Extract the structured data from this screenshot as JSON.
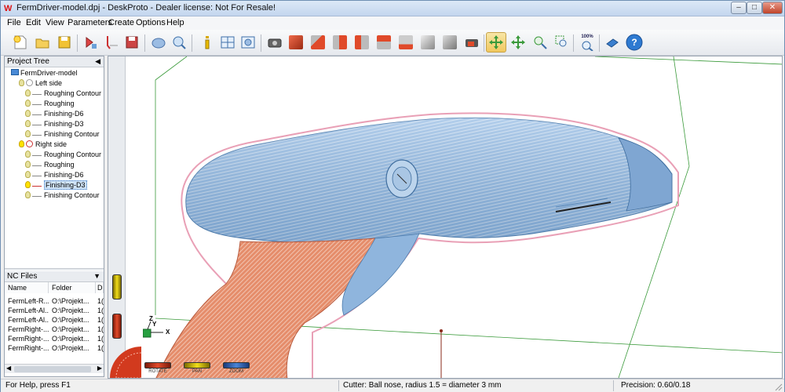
{
  "window": {
    "title": "FermDriver-model.dpj - DeskProto - Dealer license: Not For Resale!",
    "app_icon_glyph": "W"
  },
  "window_controls": {
    "minimize": "–",
    "maximize": "□",
    "close": "✕"
  },
  "menu": [
    "File",
    "Edit",
    "View",
    "Parameters",
    "Create",
    "Options",
    "Help"
  ],
  "toolbar": {
    "icons": [
      "new-file-icon",
      "open-folder-icon",
      "save-icon",
      "part-import-icon",
      "calculate-toolpath-icon",
      "save-nc-icon",
      "shaded-view-icon",
      "zoom-view-icon",
      "info-icon",
      "layout-icon",
      "preview-icon",
      "camera-icon",
      "view-top-icon",
      "view-front-icon",
      "view-right-icon",
      "view-left-icon",
      "view-back-icon",
      "view-bottom-icon",
      "view-iso-icon",
      "view-wireframe-icon",
      "render-icon",
      "rotate-mode-icon",
      "pan-mode-icon",
      "zoom-mode-icon",
      "zoom-window-icon",
      "zoom-100-icon",
      "library-icon",
      "help-icon"
    ],
    "zoom_label": "100%",
    "active": "rotate-mode-icon"
  },
  "project_tree": {
    "header": "Project Tree",
    "collapse_arrow": "◀",
    "root": "FermDriver-model",
    "parts": [
      {
        "name": "Left side",
        "operations": [
          "Roughing Contour",
          "Roughing",
          "Finishing-D6",
          "Finishing-D3",
          "Finishing Contour"
        ]
      },
      {
        "name": "Right side",
        "operations": [
          "Roughing Contour",
          "Roughing",
          "Finishing-D6",
          "Finishing-D3",
          "Finishing Contour"
        ]
      }
    ],
    "selected": "Right side / Finishing-D3"
  },
  "nc_files": {
    "header": "NC Files",
    "collapse_arrow": "▼",
    "columns": [
      "Name",
      "Folder",
      "D"
    ],
    "rows": [
      [
        "FermLeft-R...",
        "O:\\Projekt...",
        "1("
      ],
      [
        "FermLeft-Al...",
        "O:\\Projekt...",
        "1("
      ],
      [
        "FermLeft-Al...",
        "O:\\Projekt...",
        "1("
      ],
      [
        "FermRight-...",
        "O:\\Projekt...",
        "1("
      ],
      [
        "FermRight-...",
        "O:\\Projekt...",
        "1("
      ],
      [
        "FermRight-...",
        "O:\\Projekt...",
        "1("
      ]
    ],
    "scroll_left": "◀",
    "scroll_right": "▶"
  },
  "viewport": {
    "axes": {
      "x": "X",
      "y": "Y",
      "z": "Z"
    },
    "wheels": [
      "ROTATE",
      "PAN",
      "ZOOM"
    ],
    "colors": {
      "part_blue": "#8fb5dd",
      "toolpath_orange": "#e88a6a",
      "bounding_green": "#3a9a3a",
      "rotate_wheel": "#d23a1e",
      "pan_wheel": "#d9c400",
      "zoom_wheel": "#3a6fc8"
    }
  },
  "statusbar": {
    "help": "For Help, press F1",
    "cutter": "Cutter: Ball nose, radius 1.5 = diameter 3 mm",
    "precision": "Precision: 0.60/0.18"
  }
}
